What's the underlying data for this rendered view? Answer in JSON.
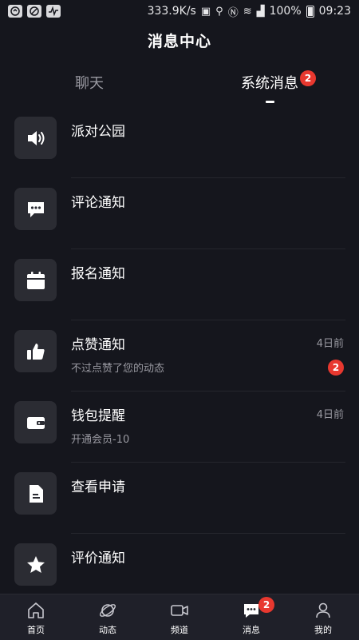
{
  "status_bar": {
    "speed": "333.9K/s",
    "battery": "100%",
    "time": "09:23"
  },
  "header": {
    "title": "消息中心"
  },
  "tabs": {
    "chat_label": "聊天",
    "system_label": "系统消息",
    "system_badge": "2"
  },
  "messages": [
    {
      "title": "派对公园",
      "subtitle": "",
      "time": "",
      "badge": "",
      "icon": "speaker-icon"
    },
    {
      "title": "评论通知",
      "subtitle": "",
      "time": "",
      "badge": "",
      "icon": "comment-icon"
    },
    {
      "title": "报名通知",
      "subtitle": "",
      "time": "",
      "badge": "",
      "icon": "calendar-icon"
    },
    {
      "title": "点赞通知",
      "subtitle": "不过点赞了您的动态",
      "time": "4日前",
      "badge": "2",
      "icon": "thumbs-up-icon"
    },
    {
      "title": "钱包提醒",
      "subtitle": "开通会员-10",
      "time": "4日前",
      "badge": "",
      "icon": "wallet-icon"
    },
    {
      "title": "查看申请",
      "subtitle": "",
      "time": "",
      "badge": "",
      "icon": "document-icon"
    },
    {
      "title": "评价通知",
      "subtitle": "",
      "time": "",
      "badge": "",
      "icon": "star-icon"
    }
  ],
  "bottom_nav": {
    "home": "首页",
    "feed": "动态",
    "channel": "频道",
    "messages": "消息",
    "messages_badge": "2",
    "me": "我的"
  },
  "colors": {
    "background": "#15161d",
    "icon_tile": "#2b2c33",
    "badge": "#e8382f",
    "nav_background": "#1f2029"
  }
}
